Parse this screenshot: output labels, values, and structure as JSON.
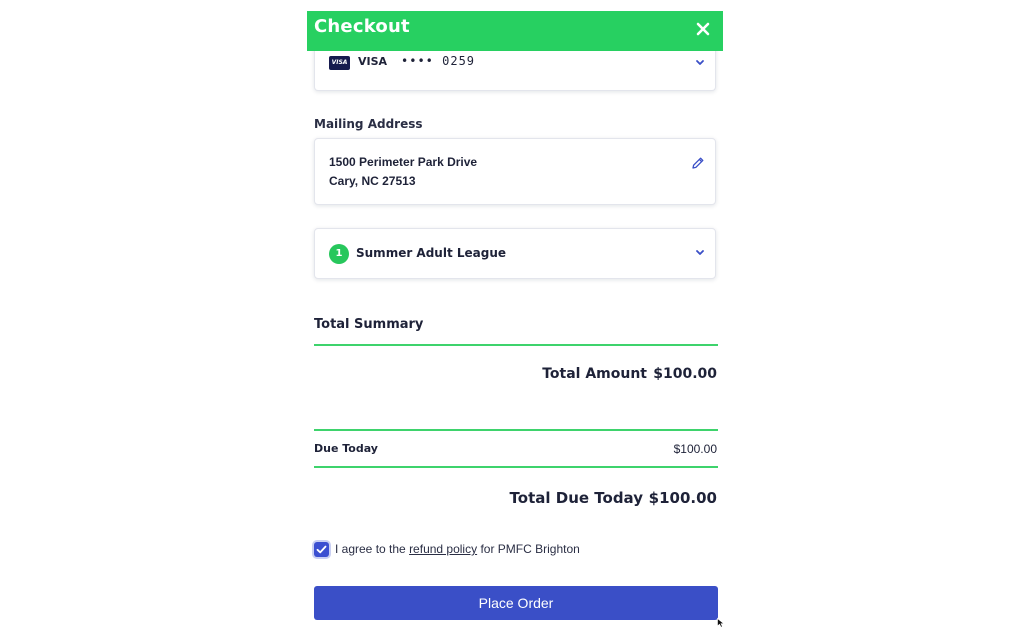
{
  "header": {
    "title": "Checkout",
    "close_icon": "close-icon"
  },
  "payment": {
    "brand_badge": "VISA",
    "brand_label": "VISA",
    "masked_number": "•••• 0259",
    "expand_icon": "chevron-down-icon"
  },
  "mailing": {
    "label": "Mailing Address",
    "line1": "1500 Perimeter Park Drive",
    "line2": "Cary, NC 27513",
    "edit_icon": "pencil-icon"
  },
  "league": {
    "number": "1",
    "name": "Summer Adult League",
    "expand_icon": "chevron-down-icon"
  },
  "summary": {
    "title": "Total Summary",
    "total_amount_label": "Total Amount",
    "total_amount_value": "$100.00",
    "due_today_label": "Due Today",
    "due_today_value": "$100.00",
    "total_due_label": "Total Due Today",
    "total_due_value": "$100.00"
  },
  "agreement": {
    "checked": true,
    "prefix": "I agree to the ",
    "link": "refund policy",
    "suffix": " for PMFC Brighton"
  },
  "actions": {
    "place_order_label": "Place Order"
  },
  "colors": {
    "header_green": "#27d061",
    "accent_blue": "#3a4fc7",
    "divider_green": "#3ed36c",
    "text_dark": "#1e2238"
  }
}
